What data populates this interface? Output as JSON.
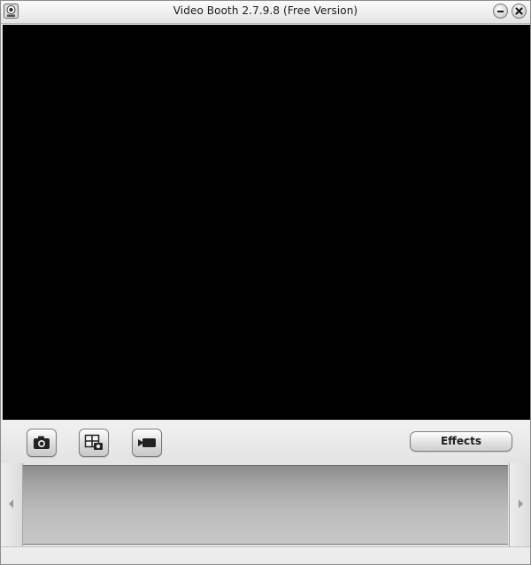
{
  "window": {
    "title": "Video Booth  2.7.9.8  (Free Version)",
    "icon": "webcam-icon"
  },
  "titlebar_buttons": [
    {
      "name": "minimize",
      "icon": "minimize-icon"
    },
    {
      "name": "close",
      "icon": "close-icon"
    }
  ],
  "toolbar": {
    "photo_icon": "camera-icon",
    "multi_photo_icon": "photo-grid-icon",
    "video_icon": "video-camera-icon",
    "effects_label": "Effects"
  },
  "gallery": {
    "left_arrow": "chevron-left-icon",
    "right_arrow": "chevron-right-icon"
  },
  "colors": {
    "video_background": "#000000",
    "window_background": "#e9e9e9",
    "strip_background": "#a6a6a6"
  }
}
